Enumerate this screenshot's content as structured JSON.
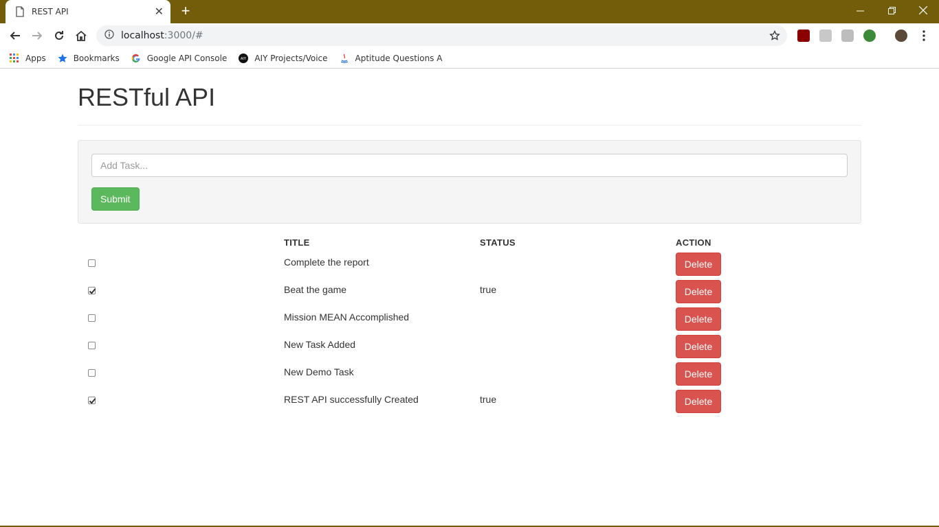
{
  "browser": {
    "tab_title": "REST API",
    "url_host": "localhost",
    "url_path": ":3000/#",
    "bookmarks": [
      {
        "label": "Apps",
        "icon": "apps-grid-icon"
      },
      {
        "label": "Bookmarks",
        "icon": "star-icon"
      },
      {
        "label": "Google API Console",
        "icon": "google-icon"
      },
      {
        "label": "AIY Projects/Voice",
        "icon": "aiy-icon"
      },
      {
        "label": "Aptitude Questions A",
        "icon": "java-icon"
      }
    ],
    "colors": {
      "frame": "#735c0a"
    }
  },
  "page": {
    "title": "RESTful API",
    "input_placeholder": "Add Task...",
    "submit_label": "Submit",
    "columns": [
      "",
      "TITLE",
      "STATUS",
      "ACTION"
    ],
    "tasks": [
      {
        "checked": false,
        "title": "Complete the report",
        "status": "",
        "action": "Delete"
      },
      {
        "checked": true,
        "title": "Beat the game",
        "status": "true",
        "action": "Delete"
      },
      {
        "checked": false,
        "title": "Mission MEAN Accomplished",
        "status": "",
        "action": "Delete"
      },
      {
        "checked": false,
        "title": "New Task Added",
        "status": "",
        "action": "Delete"
      },
      {
        "checked": false,
        "title": "New Demo Task",
        "status": "",
        "action": "Delete"
      },
      {
        "checked": true,
        "title": "REST API successfully Created",
        "status": "true",
        "action": "Delete"
      }
    ],
    "colors": {
      "success": "#5cb85c",
      "danger": "#d9534f"
    }
  }
}
